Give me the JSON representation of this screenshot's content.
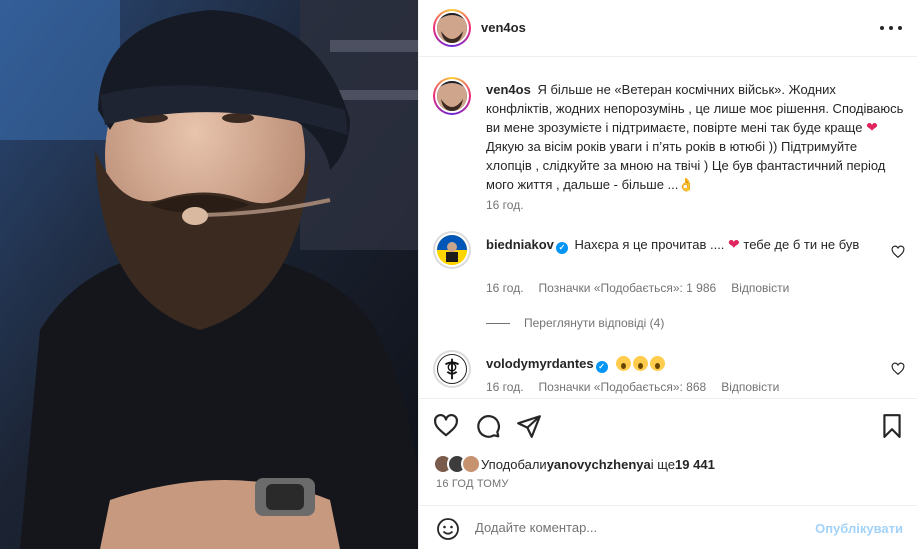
{
  "post": {
    "author": "ven4os",
    "more_icon": "more-horizontal-icon"
  },
  "caption": {
    "author": "ven4os",
    "text_part1": "Я більше не «Ветеран космічних військ». Жодних конфліктів, жодних непорозумінь , це лише моє рішення. Сподіваюсь ви мене зрозумієте і підтримаєте, повірте мені так буде краще",
    "heart": "❤",
    "text_part2": " Дякую за вісім років уваги і п’ять років в ютюбі )) Підтримуйте хлопців , слідкуйте за мною на твічі ) Це був фантастичний період мого життя , дальше - більше ...",
    "hand_emoji": "👌",
    "time": "16 год."
  },
  "comments": [
    {
      "author": "biedniakov",
      "verified_mark": "✓",
      "text_part1": "Нахєра я це прочитав ....",
      "heart": "❤",
      "text_part2": " тебе де б ти не був",
      "time": "16 год.",
      "likes": "Позначки «Подобається»: 1 986",
      "reply": "Відповісти"
    },
    {
      "author": "volodymyrdantes",
      "verified_mark": "✓",
      "time": "16 год.",
      "likes": "Позначки «Подобається»: 868",
      "reply": "Відповісти"
    }
  ],
  "view_replies": "Переглянути відповіді (4)",
  "likes_summary": {
    "prefix": "Уподобали ",
    "user": "yanovychzhenya",
    "suffix": " і ще ",
    "count": "19 441"
  },
  "post_time": "16 ГОД ТОМУ",
  "comment_box": {
    "placeholder": "Додайте коментар...",
    "publish": "Опублікувати"
  },
  "colors": {
    "accent": "#0095f6",
    "publish_disabled": "#a3d3fa",
    "heart": "#e0245e"
  }
}
